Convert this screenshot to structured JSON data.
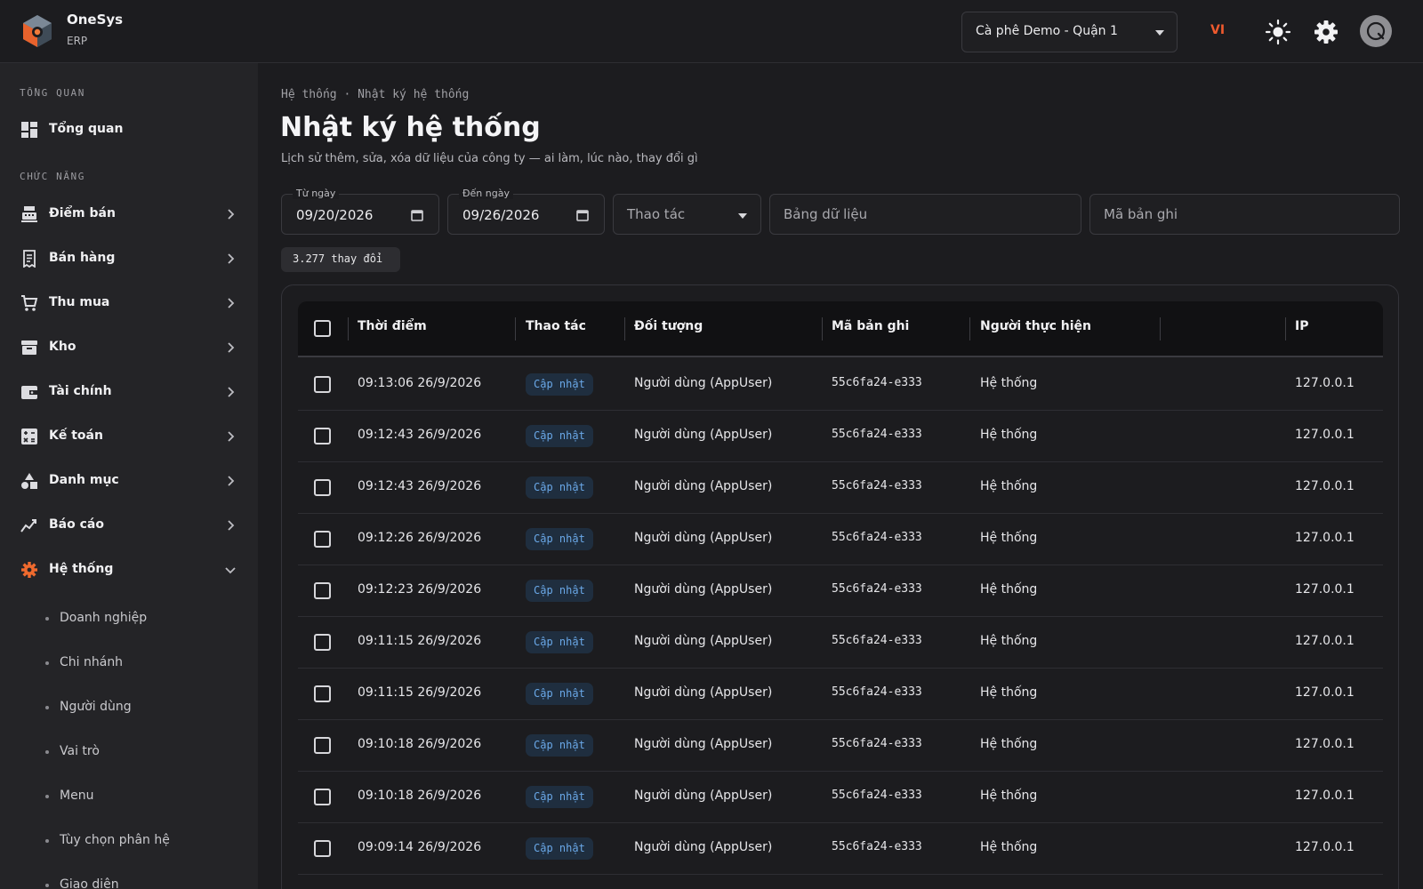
{
  "header": {
    "brand_name": "OneSys",
    "brand_sub": "ERP",
    "branch": "Cà phê Demo - Quận 1",
    "lang": "VI"
  },
  "sidebar": {
    "section_overview": "TỔNG QUAN",
    "overview_item": "Tổng quan",
    "section_functions": "CHỨC NĂNG",
    "items": [
      {
        "label": "Điểm bán",
        "icon": "pos-icon"
      },
      {
        "label": "Bán hàng",
        "icon": "receipt-icon"
      },
      {
        "label": "Thu mua",
        "icon": "cart-icon"
      },
      {
        "label": "Kho",
        "icon": "archive-icon"
      },
      {
        "label": "Tài chính",
        "icon": "wallet-icon"
      },
      {
        "label": "Kế toán",
        "icon": "calculator-icon"
      },
      {
        "label": "Danh mục",
        "icon": "shapes-icon"
      },
      {
        "label": "Báo cáo",
        "icon": "chart-icon"
      },
      {
        "label": "Hệ thống",
        "icon": "gear-icon",
        "active": true
      }
    ],
    "sub_items": [
      "Doanh nghiệp",
      "Chi nhánh",
      "Người dùng",
      "Vai trò",
      "Menu",
      "Tùy chọn phân hệ",
      "Giao diện"
    ],
    "accent_color": "#ef6a2e"
  },
  "main": {
    "breadcrumb": "Hệ thống · Nhật ký hệ thống",
    "title": "Nhật ký hệ thống",
    "subtitle": "Lịch sử thêm, sửa, xóa dữ liệu của công ty — ai làm, lúc nào, thay đổi gì",
    "filters": {
      "from_label": "Từ ngày",
      "from_value": "09/20/2026",
      "to_label": "Đến ngày",
      "to_value": "09/26/2026",
      "action_placeholder": "Thao tác",
      "table_placeholder": "Bảng dữ liệu",
      "record_placeholder": "Mã bản ghi"
    },
    "count": "3.277 thay đổi"
  },
  "table": {
    "columns": [
      "Thời điểm",
      "Thao tác",
      "Đối tượng",
      "Mã bản ghi",
      "Người thực hiện",
      "IP"
    ],
    "rows": [
      {
        "time": "09:13:06 26/9/2026",
        "action": "Cập nhật",
        "object": "Người dùng (AppUser)",
        "record": "55c6fa24-e333",
        "user": "Hệ thống",
        "ip": "127.0.0.1"
      },
      {
        "time": "09:12:43 26/9/2026",
        "action": "Cập nhật",
        "object": "Người dùng (AppUser)",
        "record": "55c6fa24-e333",
        "user": "Hệ thống",
        "ip": "127.0.0.1"
      },
      {
        "time": "09:12:43 26/9/2026",
        "action": "Cập nhật",
        "object": "Người dùng (AppUser)",
        "record": "55c6fa24-e333",
        "user": "Hệ thống",
        "ip": "127.0.0.1"
      },
      {
        "time": "09:12:26 26/9/2026",
        "action": "Cập nhật",
        "object": "Người dùng (AppUser)",
        "record": "55c6fa24-e333",
        "user": "Hệ thống",
        "ip": "127.0.0.1"
      },
      {
        "time": "09:12:23 26/9/2026",
        "action": "Cập nhật",
        "object": "Người dùng (AppUser)",
        "record": "55c6fa24-e333",
        "user": "Hệ thống",
        "ip": "127.0.0.1"
      },
      {
        "time": "09:11:15 26/9/2026",
        "action": "Cập nhật",
        "object": "Người dùng (AppUser)",
        "record": "55c6fa24-e333",
        "user": "Hệ thống",
        "ip": "127.0.0.1"
      },
      {
        "time": "09:11:15 26/9/2026",
        "action": "Cập nhật",
        "object": "Người dùng (AppUser)",
        "record": "55c6fa24-e333",
        "user": "Hệ thống",
        "ip": "127.0.0.1"
      },
      {
        "time": "09:10:18 26/9/2026",
        "action": "Cập nhật",
        "object": "Người dùng (AppUser)",
        "record": "55c6fa24-e333",
        "user": "Hệ thống",
        "ip": "127.0.0.1"
      },
      {
        "time": "09:10:18 26/9/2026",
        "action": "Cập nhật",
        "object": "Người dùng (AppUser)",
        "record": "55c6fa24-e333",
        "user": "Hệ thống",
        "ip": "127.0.0.1"
      },
      {
        "time": "09:09:14 26/9/2026",
        "action": "Cập nhật",
        "object": "Người dùng (AppUser)",
        "record": "55c6fa24-e333",
        "user": "Hệ thống",
        "ip": "127.0.0.1"
      }
    ]
  }
}
